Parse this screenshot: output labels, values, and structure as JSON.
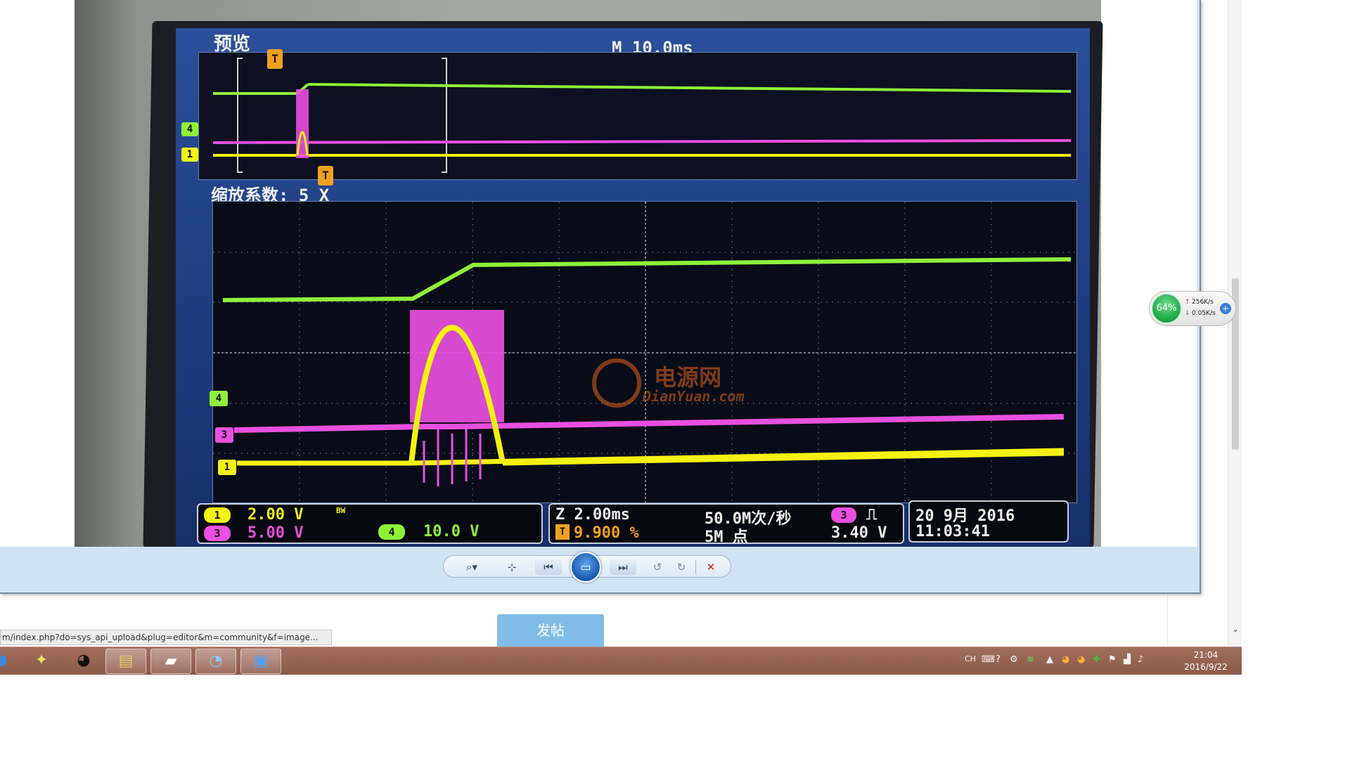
{
  "scope": {
    "preview_label": "预览",
    "timebase": "M 10.0ms",
    "zoom_label": "缩放系数: 5 X",
    "trigger_marker": "T",
    "channel_markers": {
      "ch1": "1",
      "ch3": "3",
      "ch4": "4"
    },
    "ch1_scale": "2.00 V",
    "bw_mark": "BW",
    "ch3_scale": "5.00 V",
    "ch4_scale": "10.0 V",
    "zoom_timebase": "Z 2.00ms",
    "trigger_position": "9.900 %",
    "sample_rate": "50.0M次/秒",
    "record_length": "5M 点",
    "trigger_channel": "3",
    "trigger_level": "3.40 V",
    "date": "20 9月 2016",
    "time": "11:03:41",
    "watermark_cn": "电源网",
    "watermark_en": "DianYuan.com"
  },
  "viewer_toolbar": {
    "zoom_icon": "magnifier-icon",
    "fit_icon": "fit-window-icon",
    "prev_icon": "previous-icon",
    "slideshow_icon": "slideshow-icon",
    "next_icon": "next-icon",
    "rotate_left_icon": "rotate-ccw-icon",
    "rotate_right_icon": "rotate-cw-icon",
    "delete_icon": "delete-icon"
  },
  "page": {
    "post_button": "发帖",
    "status_url": "m/index.php?do=sys_api_upload&plug=editor&m=community&f=image..."
  },
  "net_widget": {
    "percent": "64%",
    "upload": "256K/s",
    "download": "0.05K/s"
  },
  "taskbar": {
    "apps": [
      "chrome-icon",
      "network-icon",
      "qq-icon",
      "file-explorer-icon",
      "book-icon",
      "paint-icon",
      "photo-viewer-icon"
    ],
    "tray": {
      "lang": "CH",
      "time": "21:04",
      "date": "2016/9/22"
    }
  },
  "colors": {
    "ch1_yellow": "#f4f212",
    "ch3_magenta": "#e94fe0",
    "ch4_green": "#8ff03a",
    "scope_bg": "#1d3a7c",
    "taskbar": "#9a6656",
    "viewer_bg": "#cfe3f5"
  }
}
